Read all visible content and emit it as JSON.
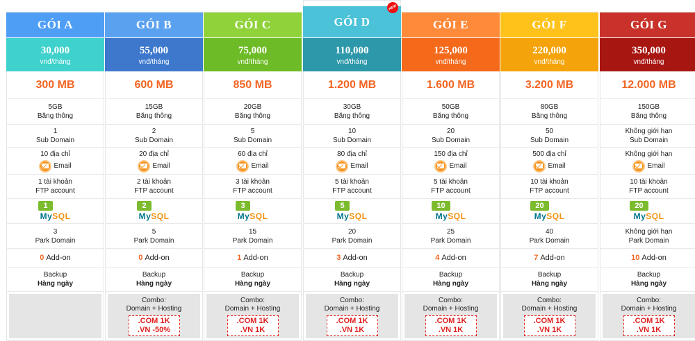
{
  "labels": {
    "per_month": "vnđ/tháng",
    "bandwidth": "Băng thông",
    "sub_domain": "Sub Domain",
    "email": "Email",
    "ftp": "FTP account",
    "park_domain": "Park Domain",
    "addon": "Add-on",
    "backup": "Backup",
    "combo": "Combo:",
    "combo_sub": "Domain + Hosting",
    "mysql_my": "My",
    "mysql_sql": "SQL",
    "new_badge": "NEW"
  },
  "colors": {
    "storage": "#f26522",
    "mysql_badge": "#7dbb2e",
    "promo": "#e02020"
  },
  "plans": [
    {
      "name": "GÓI A",
      "price": "30,000",
      "head_color": "#4e9ef5",
      "price_color": "#3fd1cc",
      "storage": "300 MB",
      "bandwidth": "5GB",
      "sub_domain": "1",
      "email": "10 địa chỉ",
      "ftp": "1 tài khoản",
      "mysql": "1",
      "park": "3",
      "addon": "0",
      "backup": "Hàng ngày",
      "combo": false
    },
    {
      "name": "GÓI B",
      "price": "55,000",
      "head_color": "#5aa2f0",
      "price_color": "#3d78cc",
      "storage": "600 MB",
      "bandwidth": "15GB",
      "sub_domain": "2",
      "email": "20 địa chỉ",
      "ftp": "2 tài khoản",
      "mysql": "2",
      "park": "5",
      "addon": "0",
      "backup": "Hàng ngày",
      "combo": true,
      "promo1": ".COM 1K",
      "promo2": ".VN -50%"
    },
    {
      "name": "GÓI C",
      "price": "75,000",
      "head_color": "#8fd23a",
      "price_color": "#6dbb26",
      "storage": "850 MB",
      "bandwidth": "20GB",
      "sub_domain": "5",
      "email": "60 địa chỉ",
      "ftp": "3 tài khoản",
      "mysql": "3",
      "park": "15",
      "addon": "1",
      "backup": "Hàng ngày",
      "combo": true,
      "promo1": ".COM 1K",
      "promo2": ".VN 1K"
    },
    {
      "name": "GÓI D",
      "price": "110,000",
      "head_color": "#4cc2d8",
      "price_color": "#2d98aa",
      "storage": "1.200 MB",
      "bandwidth": "30GB",
      "sub_domain": "10",
      "email": "80 địa chỉ",
      "ftp": "5 tài khoản",
      "mysql": "5",
      "park": "20",
      "addon": "3",
      "backup": "Hàng ngày",
      "combo": true,
      "promo1": ".COM 1K",
      "promo2": ".VN 1K",
      "featured": true
    },
    {
      "name": "GÓI E",
      "price": "125,000",
      "head_color": "#ff8a3a",
      "price_color": "#f4691a",
      "storage": "1.600 MB",
      "bandwidth": "50GB",
      "sub_domain": "20",
      "email": "150 địa chỉ",
      "ftp": "5 tài khoản",
      "mysql": "10",
      "park": "25",
      "addon": "4",
      "backup": "Hàng ngày",
      "combo": true,
      "promo1": ".COM 1K",
      "promo2": ".VN 1K"
    },
    {
      "name": "GÓI F",
      "price": "220,000",
      "head_color": "#ffc21a",
      "price_color": "#f5a30a",
      "storage": "3.200 MB",
      "bandwidth": "80GB",
      "sub_domain": "50",
      "email": "500 địa chỉ",
      "ftp": "10 tài khoản",
      "mysql": "20",
      "park": "40",
      "addon": "7",
      "backup": "Hàng ngày",
      "combo": true,
      "promo1": ".COM 1K",
      "promo2": ".VN 1K"
    },
    {
      "name": "GÓI G",
      "price": "350,000",
      "head_color": "#c8322a",
      "price_color": "#a81612",
      "storage": "12.000 MB",
      "bandwidth": "150GB",
      "sub_domain": "Không giới hạn",
      "email": "Không giới hạn",
      "ftp": "10 tài khoản",
      "mysql": "20",
      "park": "Không giới hạn",
      "addon": "10",
      "backup": "Hàng ngày",
      "combo": true,
      "promo1": ".COM 1K",
      "promo2": ".VN 1K"
    }
  ]
}
